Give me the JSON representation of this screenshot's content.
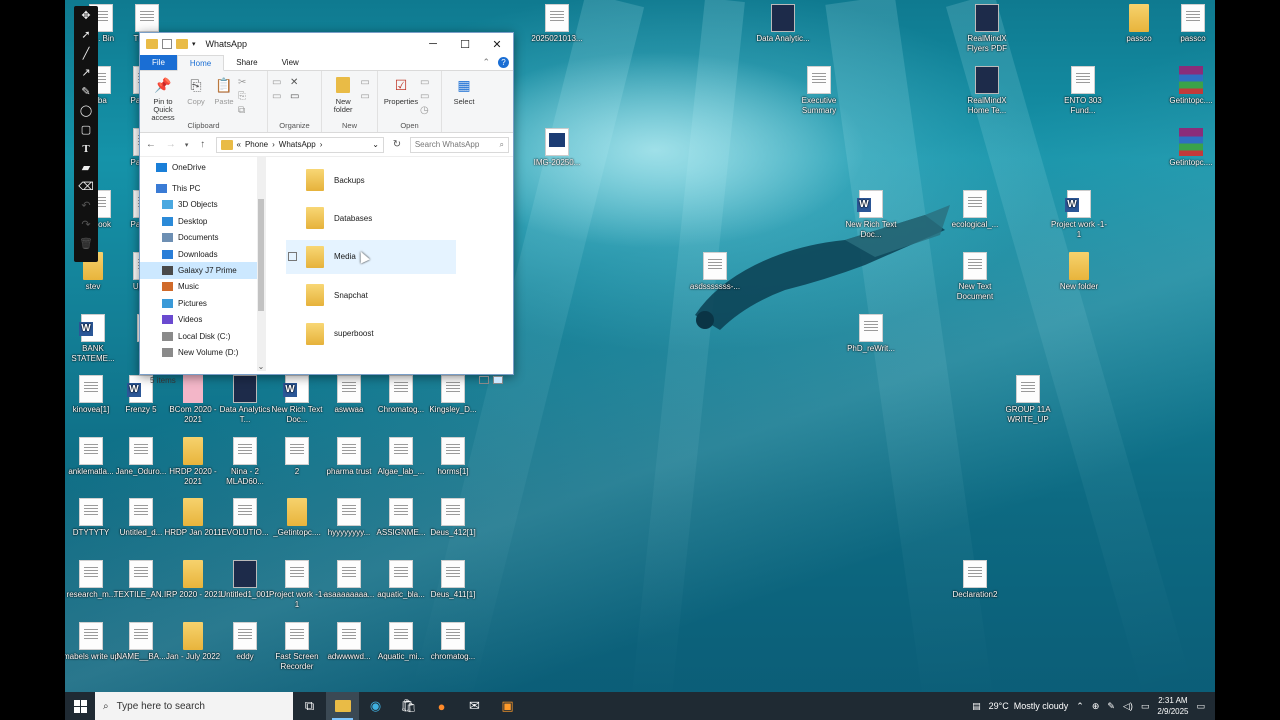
{
  "explorer": {
    "title": "WhatsApp",
    "tabs": [
      "File",
      "Home",
      "Share",
      "View"
    ],
    "ribbon": {
      "clipboard": {
        "pin": "Pin to Quick access",
        "copy": "Copy",
        "paste": "Paste",
        "label": "Clipboard"
      },
      "organize": {
        "label": "Organize"
      },
      "new": {
        "new_folder": "New folder",
        "label": "New"
      },
      "open": {
        "properties": "Properties",
        "label": "Open"
      },
      "select": {
        "select": "Select"
      }
    },
    "address": {
      "prefix": "«",
      "segments": [
        "Phone",
        "WhatsApp"
      ]
    },
    "search_placeholder": "Search WhatsApp",
    "nav": [
      {
        "label": "OneDrive",
        "icon": "cloud-icon"
      },
      {
        "label": "This PC",
        "icon": "computer-icon"
      },
      {
        "label": "3D Objects",
        "icon": "cube-icon"
      },
      {
        "label": "Desktop",
        "icon": "desktop-icon"
      },
      {
        "label": "Documents",
        "icon": "documents-icon"
      },
      {
        "label": "Downloads",
        "icon": "download-icon"
      },
      {
        "label": "Galaxy J7 Prime",
        "icon": "phone-icon"
      },
      {
        "label": "Music",
        "icon": "music-icon"
      },
      {
        "label": "Pictures",
        "icon": "pictures-icon"
      },
      {
        "label": "Videos",
        "icon": "video-icon"
      },
      {
        "label": "Local Disk (C:)",
        "icon": "drive-icon"
      },
      {
        "label": "New Volume (D:)",
        "icon": "drive-icon"
      }
    ],
    "files": [
      "Backups",
      "Databases",
      "Media",
      "Snapchat",
      "superboost"
    ],
    "status": "5 items"
  },
  "desktop_icons": [
    {
      "label": "R... Bin",
      "type": "doc"
    },
    {
      "label": "The_f...",
      "type": "doc"
    },
    {
      "label": "2025021013...",
      "type": "doc"
    },
    {
      "label": "Data Analytic...",
      "type": "dark"
    },
    {
      "label": "RealMindX Flyers PDF",
      "type": "dark"
    },
    {
      "label": "passco",
      "type": "folder"
    },
    {
      "label": "passco",
      "type": "doc"
    },
    {
      "label": "Executive Summary",
      "type": "doc"
    },
    {
      "label": "RealMindX Home Te...",
      "type": "dark"
    },
    {
      "label": "ENTO 303 Fund...",
      "type": "doc"
    },
    {
      "label": "Getintopc....",
      "type": "rar"
    },
    {
      "label": "Getintopc....",
      "type": "rar"
    },
    {
      "label": "IMG-20250...",
      "type": "pdf"
    },
    {
      "label": "New Rich Text Doc...",
      "type": "word"
    },
    {
      "label": "ecological_...",
      "type": "doc"
    },
    {
      "label": "Project work -1-1",
      "type": "word"
    },
    {
      "label": "asdsssssss-...",
      "type": "doc"
    },
    {
      "label": "New Text Document",
      "type": "doc"
    },
    {
      "label": "New folder",
      "type": "folder"
    },
    {
      "label": "PhD_reWrit...",
      "type": "doc"
    },
    {
      "label": "GROUP 11A WRITE_UP",
      "type": "doc"
    },
    {
      "label": "Declaration2",
      "type": "doc"
    },
    {
      "label": "stev",
      "type": "folder"
    },
    {
      "label": "Upcy...",
      "type": "doc"
    },
    {
      "label": "BANK STATEME...",
      "type": "word"
    },
    {
      "label": "Fre...",
      "type": "doc"
    },
    {
      "label": "kinovea[1]",
      "type": "doc"
    },
    {
      "label": "Frenzy 5",
      "type": "word"
    },
    {
      "label": "BCom 2020 - 2021",
      "type": "pink"
    },
    {
      "label": "Data Analytics T...",
      "type": "dark"
    },
    {
      "label": "New Rich Text Doc...",
      "type": "word"
    },
    {
      "label": "aswwaa",
      "type": "doc"
    },
    {
      "label": "Chromatog...",
      "type": "doc"
    },
    {
      "label": "Kingsley_D...",
      "type": "doc"
    },
    {
      "label": "anklematla...",
      "type": "doc"
    },
    {
      "label": "Jane_Oduro...",
      "type": "doc"
    },
    {
      "label": "HRDP 2020 - 2021",
      "type": "folder"
    },
    {
      "label": "Nina - 2 MLAD60...",
      "type": "doc"
    },
    {
      "label": "2",
      "type": "doc"
    },
    {
      "label": "pharma trust",
      "type": "doc"
    },
    {
      "label": "Algae_lab_...",
      "type": "doc"
    },
    {
      "label": "horms[1]",
      "type": "doc"
    },
    {
      "label": "DTYTYTY",
      "type": "doc"
    },
    {
      "label": "Untitled_d...",
      "type": "doc"
    },
    {
      "label": "HRDP Jan 2011",
      "type": "folder"
    },
    {
      "label": "EVOLUTIO...",
      "type": "doc"
    },
    {
      "label": "_Getintopc....",
      "type": "folder"
    },
    {
      "label": "hyyyyyyyy...",
      "type": "doc"
    },
    {
      "label": "ASSIGNME...",
      "type": "doc"
    },
    {
      "label": "Deus_412[1]",
      "type": "doc"
    },
    {
      "label": "research_m...",
      "type": "doc"
    },
    {
      "label": "TEXTILE_AN...",
      "type": "doc"
    },
    {
      "label": "IRP 2020 - 2021",
      "type": "folder"
    },
    {
      "label": "Untitled1_001",
      "type": "dark"
    },
    {
      "label": "Project work -1-1",
      "type": "doc"
    },
    {
      "label": "asaaaaaaaa...",
      "type": "doc"
    },
    {
      "label": "aquatic_bla...",
      "type": "doc"
    },
    {
      "label": "Deus_411[1]",
      "type": "doc"
    },
    {
      "label": "mabels write up",
      "type": "doc"
    },
    {
      "label": "NAME__BA...",
      "type": "doc"
    },
    {
      "label": "Jan - July 2022",
      "type": "folder"
    },
    {
      "label": "eddy",
      "type": "doc"
    },
    {
      "label": "Fast Screen Recorder",
      "type": "doc"
    },
    {
      "label": "adwwwwd...",
      "type": "doc"
    },
    {
      "label": "Aquatic_mi...",
      "type": "doc"
    },
    {
      "label": "chromatog...",
      "type": "doc"
    },
    {
      "label": "Pasco...",
      "type": "doc"
    },
    {
      "label": "Pasco...",
      "type": "doc"
    },
    {
      "label": "Pasco...",
      "type": "doc"
    },
    {
      "label": "...ba",
      "type": "doc"
    },
    {
      "label": "...book",
      "type": "doc"
    }
  ],
  "taskbar": {
    "search_placeholder": "Type here to search",
    "weather": "29°C  Mostly cloudy",
    "time": "2:31 AM",
    "date": "2/9/2025"
  },
  "colors": {
    "accent": "#1a6ed4",
    "selection": "#cce8ff",
    "hover": "#e5f3ff",
    "taskbar": "#1f2a33"
  }
}
